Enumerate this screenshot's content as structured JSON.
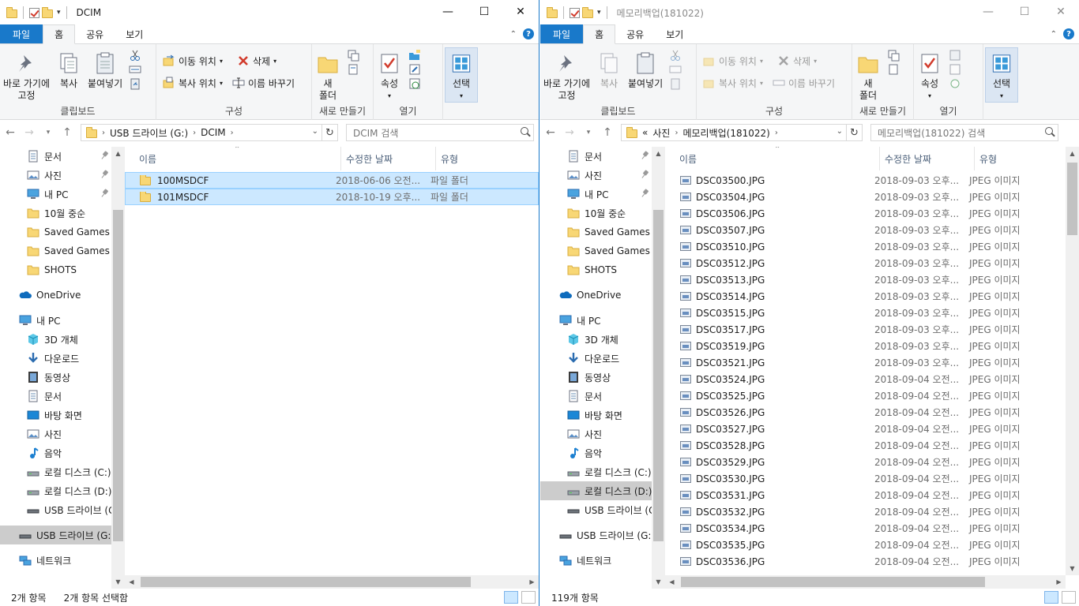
{
  "left": {
    "title": "DCIM",
    "tabs": {
      "file": "파일",
      "home": "홈",
      "share": "공유",
      "view": "보기"
    },
    "ribbon": {
      "pin": "바로 가기에\n고정",
      "copy": "복사",
      "paste": "붙여넣기",
      "clipboard": "클립보드",
      "move_to": "이동 위치",
      "copy_to": "복사 위치",
      "delete": "삭제",
      "rename": "이름 바꾸기",
      "organize": "구성",
      "new_folder": "새\n폴더",
      "new": "새로 만들기",
      "properties": "속성",
      "open": "열기",
      "select": "선택"
    },
    "address": {
      "parts": [
        "USB 드라이브 (G:)",
        "DCIM"
      ]
    },
    "search_placeholder": "DCIM 검색",
    "columns": {
      "name": "이름",
      "date": "수정한 날짜",
      "type": "유형"
    },
    "nav": [
      {
        "label": "문서",
        "icon": "document-icon",
        "pin": true
      },
      {
        "label": "사진",
        "icon": "pictures-icon",
        "pin": true
      },
      {
        "label": "내 PC",
        "icon": "pc-icon",
        "pin": true
      },
      {
        "label": "10월 중순",
        "icon": "folder-icon"
      },
      {
        "label": "Saved Games",
        "icon": "folder-icon"
      },
      {
        "label": "Saved Games",
        "icon": "folder-icon"
      },
      {
        "label": "SHOTS",
        "icon": "folder-icon"
      },
      {
        "label": "OneDrive",
        "icon": "onedrive-icon",
        "gap": true
      },
      {
        "label": "내 PC",
        "icon": "pc-icon",
        "gap": true
      },
      {
        "label": "3D 개체",
        "icon": "3d-objects-icon"
      },
      {
        "label": "다운로드",
        "icon": "download-icon"
      },
      {
        "label": "동영상",
        "icon": "video-icon"
      },
      {
        "label": "문서",
        "icon": "document-icon"
      },
      {
        "label": "바탕 화면",
        "icon": "desktop-icon"
      },
      {
        "label": "사진",
        "icon": "pictures-icon"
      },
      {
        "label": "음악",
        "icon": "music-icon"
      },
      {
        "label": "로컬 디스크 (C:)",
        "icon": "drive-icon"
      },
      {
        "label": "로컬 디스크 (D:)",
        "icon": "drive-icon"
      },
      {
        "label": "USB 드라이브 (G:)",
        "icon": "usb-drive-icon"
      },
      {
        "label": "USB 드라이브 (G:)",
        "icon": "usb-drive-icon",
        "gap": true,
        "selected": true
      },
      {
        "label": "네트워크",
        "icon": "network-icon",
        "gap": true
      }
    ],
    "files": [
      {
        "name": "100MSDCF",
        "date": "2018-06-06 오전...",
        "type": "파일 폴더"
      },
      {
        "name": "101MSDCF",
        "date": "2018-10-19 오후...",
        "type": "파일 폴더"
      }
    ],
    "status": {
      "count": "2개 항목",
      "selected": "2개 항목 선택함"
    }
  },
  "right": {
    "title": "메모리백업(181022)",
    "tabs": {
      "file": "파일",
      "home": "홈",
      "share": "공유",
      "view": "보기"
    },
    "ribbon": {
      "pin": "바로 가기에\n고정",
      "copy": "복사",
      "paste": "붙여넣기",
      "clipboard": "클립보드",
      "move_to": "이동 위치",
      "copy_to": "복사 위치",
      "delete": "삭제",
      "rename": "이름 바꾸기",
      "organize": "구성",
      "new_folder": "새\n폴더",
      "new": "새로 만들기",
      "properties": "속성",
      "open": "열기",
      "select": "선택"
    },
    "address": {
      "prefix": "«",
      "parts": [
        "사진",
        "메모리백업(181022)"
      ]
    },
    "search_placeholder": "메모리백업(181022) 검색",
    "columns": {
      "name": "이름",
      "date": "수정한 날짜",
      "type": "유형"
    },
    "nav": [
      {
        "label": "문서",
        "icon": "document-icon",
        "pin": true
      },
      {
        "label": "사진",
        "icon": "pictures-icon",
        "pin": true
      },
      {
        "label": "내 PC",
        "icon": "pc-icon",
        "pin": true
      },
      {
        "label": "10월 중순",
        "icon": "folder-icon"
      },
      {
        "label": "Saved Games",
        "icon": "folder-icon"
      },
      {
        "label": "Saved Games",
        "icon": "folder-icon"
      },
      {
        "label": "SHOTS",
        "icon": "folder-icon"
      },
      {
        "label": "OneDrive",
        "icon": "onedrive-icon",
        "gap": true
      },
      {
        "label": "내 PC",
        "icon": "pc-icon",
        "gap": true
      },
      {
        "label": "3D 개체",
        "icon": "3d-objects-icon"
      },
      {
        "label": "다운로드",
        "icon": "download-icon"
      },
      {
        "label": "동영상",
        "icon": "video-icon"
      },
      {
        "label": "문서",
        "icon": "document-icon"
      },
      {
        "label": "바탕 화면",
        "icon": "desktop-icon"
      },
      {
        "label": "사진",
        "icon": "pictures-icon"
      },
      {
        "label": "음악",
        "icon": "music-icon"
      },
      {
        "label": "로컬 디스크 (C:)",
        "icon": "drive-icon"
      },
      {
        "label": "로컬 디스크 (D:)",
        "icon": "drive-icon",
        "selected": true
      },
      {
        "label": "USB 드라이브 (G:)",
        "icon": "usb-drive-icon"
      },
      {
        "label": "USB 드라이브 (G:)",
        "icon": "usb-drive-icon",
        "gap": true
      },
      {
        "label": "네트워크",
        "icon": "network-icon",
        "gap": true
      }
    ],
    "files": [
      {
        "name": "DSC03500.JPG",
        "date": "2018-09-03 오후...",
        "type": "JPEG 이미지"
      },
      {
        "name": "DSC03504.JPG",
        "date": "2018-09-03 오후...",
        "type": "JPEG 이미지"
      },
      {
        "name": "DSC03506.JPG",
        "date": "2018-09-03 오후...",
        "type": "JPEG 이미지"
      },
      {
        "name": "DSC03507.JPG",
        "date": "2018-09-03 오후...",
        "type": "JPEG 이미지"
      },
      {
        "name": "DSC03510.JPG",
        "date": "2018-09-03 오후...",
        "type": "JPEG 이미지"
      },
      {
        "name": "DSC03512.JPG",
        "date": "2018-09-03 오후...",
        "type": "JPEG 이미지"
      },
      {
        "name": "DSC03513.JPG",
        "date": "2018-09-03 오후...",
        "type": "JPEG 이미지"
      },
      {
        "name": "DSC03514.JPG",
        "date": "2018-09-03 오후...",
        "type": "JPEG 이미지"
      },
      {
        "name": "DSC03515.JPG",
        "date": "2018-09-03 오후...",
        "type": "JPEG 이미지"
      },
      {
        "name": "DSC03517.JPG",
        "date": "2018-09-03 오후...",
        "type": "JPEG 이미지"
      },
      {
        "name": "DSC03519.JPG",
        "date": "2018-09-03 오후...",
        "type": "JPEG 이미지"
      },
      {
        "name": "DSC03521.JPG",
        "date": "2018-09-03 오후...",
        "type": "JPEG 이미지"
      },
      {
        "name": "DSC03524.JPG",
        "date": "2018-09-04 오전...",
        "type": "JPEG 이미지"
      },
      {
        "name": "DSC03525.JPG",
        "date": "2018-09-04 오전...",
        "type": "JPEG 이미지"
      },
      {
        "name": "DSC03526.JPG",
        "date": "2018-09-04 오전...",
        "type": "JPEG 이미지"
      },
      {
        "name": "DSC03527.JPG",
        "date": "2018-09-04 오전...",
        "type": "JPEG 이미지"
      },
      {
        "name": "DSC03528.JPG",
        "date": "2018-09-04 오전...",
        "type": "JPEG 이미지"
      },
      {
        "name": "DSC03529.JPG",
        "date": "2018-09-04 오전...",
        "type": "JPEG 이미지"
      },
      {
        "name": "DSC03530.JPG",
        "date": "2018-09-04 오전...",
        "type": "JPEG 이미지"
      },
      {
        "name": "DSC03531.JPG",
        "date": "2018-09-04 오전...",
        "type": "JPEG 이미지"
      },
      {
        "name": "DSC03532.JPG",
        "date": "2018-09-04 오전...",
        "type": "JPEG 이미지"
      },
      {
        "name": "DSC03534.JPG",
        "date": "2018-09-04 오전...",
        "type": "JPEG 이미지"
      },
      {
        "name": "DSC03535.JPG",
        "date": "2018-09-04 오전...",
        "type": "JPEG 이미지"
      },
      {
        "name": "DSC03536.JPG",
        "date": "2018-09-04 오전...",
        "type": "JPEG 이미지"
      }
    ],
    "status": {
      "count": "119개 항목"
    }
  },
  "colors": {
    "accent": "#1979ca",
    "selection": "#cce8ff",
    "selection_border": "#99d1ff",
    "folder": "#f8d775"
  }
}
